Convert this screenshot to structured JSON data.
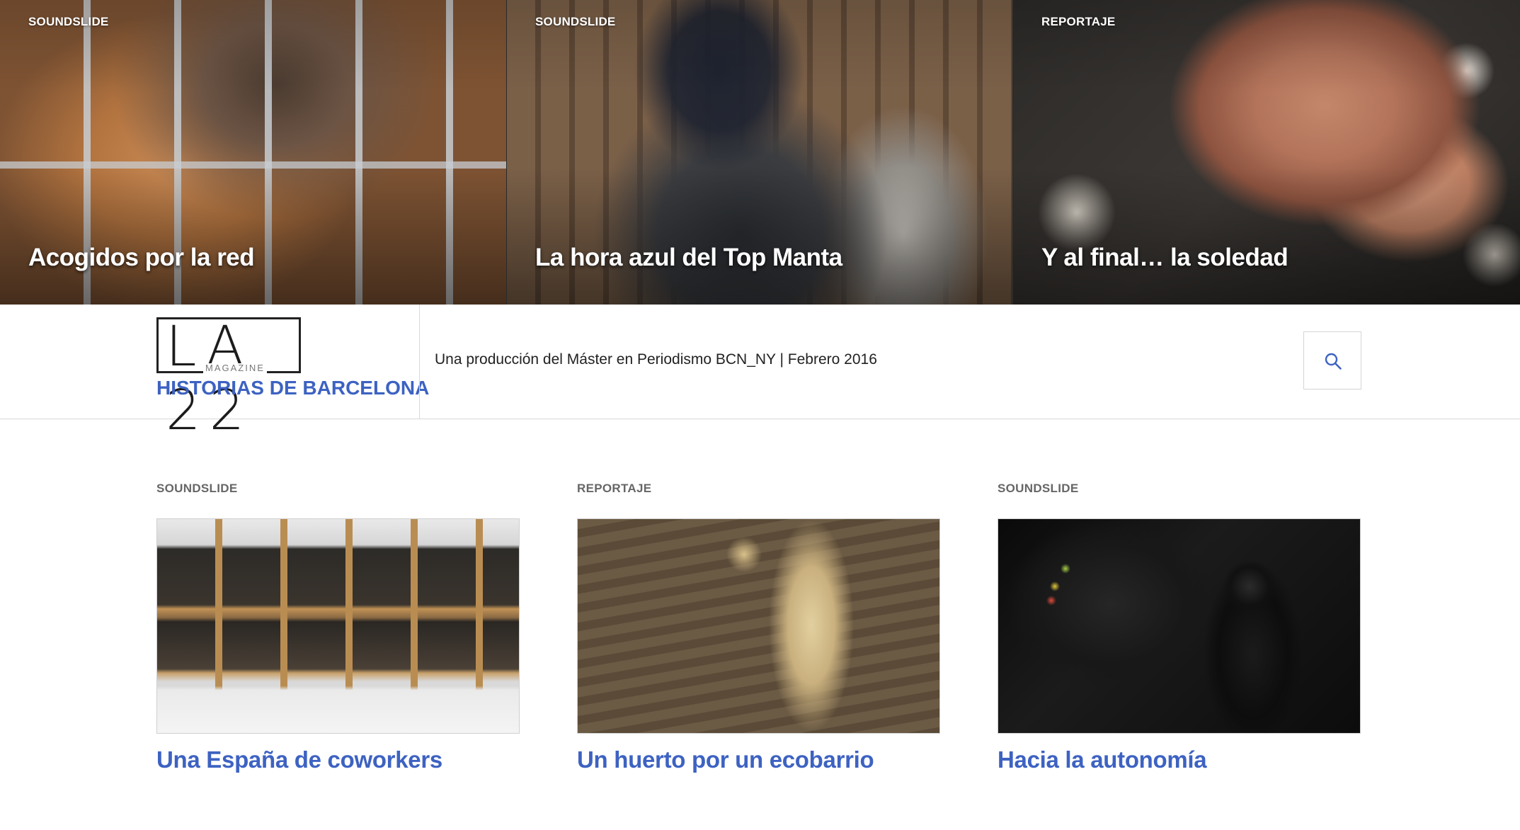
{
  "hero": [
    {
      "category": "SOUNDSLIDE",
      "title": "Acogidos por la red"
    },
    {
      "category": "SOUNDSLIDE",
      "title": "La hora azul del Top Manta"
    },
    {
      "category": "REPORTAJE",
      "title": "Y al final… la soledad"
    }
  ],
  "header": {
    "logo_main": "LA 22",
    "logo_sub": "MAGAZINE",
    "site_title": "HISTORIAS DE BARCELONA",
    "tagline": "Una producción del Máster en Periodismo BCN_NY | Febrero 2016",
    "search_icon": "search-icon"
  },
  "cards": [
    {
      "category": "SOUNDSLIDE",
      "title": "Una España de coworkers"
    },
    {
      "category": "REPORTAJE",
      "title": "Un huerto por un ecobarrio"
    },
    {
      "category": "SOUNDSLIDE",
      "title": "Hacia la autonomía"
    }
  ],
  "colors": {
    "accent": "#3d62c2",
    "category_gray": "#666666"
  }
}
